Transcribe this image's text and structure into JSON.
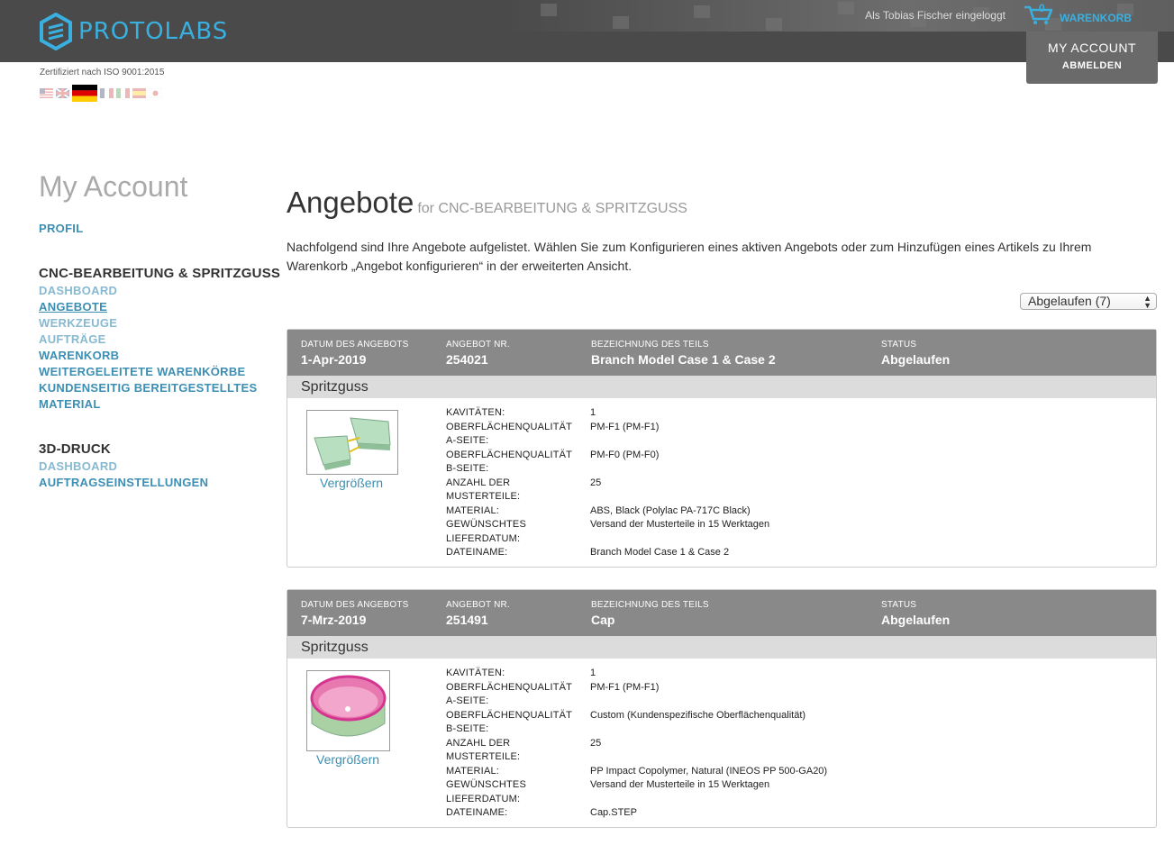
{
  "header": {
    "logo_text": "PROTOLABS",
    "logged_in": "Als Tobias Fischer eingeloggt",
    "cart_count": "0",
    "cart_label": "WARENKORB",
    "account_label": "MY ACCOUNT",
    "logout_label": "ABMELDEN",
    "iso": "Zertifiziert nach ISO 9001:2015"
  },
  "sidebar": {
    "title": "My Account",
    "profile": "PROFIL",
    "section1": "CNC-BEARBEITUNG & SPRITZGUSS",
    "items1": [
      "DASHBOARD",
      "ANGEBOTE",
      "WERKZEUGE",
      "AUFTRÄGE",
      "WARENKORB",
      "WEITERGELEITETE WARENKÖRBE",
      "KUNDENSEITIG BEREITGESTELLTES",
      "MATERIAL"
    ],
    "section2": "3D-DRUCK",
    "items2": [
      "DASHBOARD",
      "AUFTRAGSEINSTELLUNGEN"
    ]
  },
  "main": {
    "title": "Angebote",
    "subtitle": "for CNC-BEARBEITUNG & SPRITZGUSS",
    "intro": "Nachfolgend sind Ihre Angebote aufgelistet. Wählen Sie zum Konfigurieren eines aktiven Angebots oder zum Hinzufügen eines Artikels zu Ihrem Warenkorb „Angebot konfigurieren“ in der erweiterten Ansicht.",
    "filter_value": "Abgelaufen (7)",
    "col_labels": [
      "DATUM DES ANGEBOTS",
      "ANGEBOT NR.",
      "BEZEICHNUNG DES TEILS",
      "STATUS"
    ],
    "zoom_label": "Vergrößern",
    "quotes": [
      {
        "date": "1-Apr-2019",
        "number": "254021",
        "part": "Branch Model Case 1 & Case 2",
        "status": "Abgelaufen",
        "type": "Spritzguss",
        "details": [
          [
            "KAVITÄTEN:",
            "1"
          ],
          [
            "OBERFLÄCHENQUALITÄT",
            "PM-F1 (PM-F1)"
          ],
          [
            "A-SEITE:",
            ""
          ],
          [
            "OBERFLÄCHENQUALITÄT",
            "PM-F0 (PM-F0)"
          ],
          [
            "B-SEITE:",
            ""
          ],
          [
            "ANZAHL DER",
            "25"
          ],
          [
            "MUSTERTEILE:",
            ""
          ],
          [
            "MATERIAL:",
            "ABS, Black (Polylac PA-717C Black)"
          ],
          [
            "GEWÜNSCHTES",
            "Versand der Musterteile in 15 Werktagen"
          ],
          [
            "LIEFERDATUM:",
            ""
          ],
          [
            "DATEINAME:",
            "Branch Model Case 1 & Case 2"
          ]
        ]
      },
      {
        "date": "7-Mrz-2019",
        "number": "251491",
        "part": "Cap",
        "status": "Abgelaufen",
        "type": "Spritzguss",
        "details": [
          [
            "KAVITÄTEN:",
            "1"
          ],
          [
            "OBERFLÄCHENQUALITÄT",
            "PM-F1 (PM-F1)"
          ],
          [
            "A-SEITE:",
            ""
          ],
          [
            "OBERFLÄCHENQUALITÄT",
            "Custom (Kundenspezifische Oberflächenqualität)"
          ],
          [
            "B-SEITE:",
            ""
          ],
          [
            "ANZAHL DER",
            "25"
          ],
          [
            "MUSTERTEILE:",
            ""
          ],
          [
            "MATERIAL:",
            "PP Impact Copolymer, Natural (INEOS PP 500-GA20)"
          ],
          [
            "GEWÜNSCHTES",
            "Versand der Musterteile in 15 Werktagen"
          ],
          [
            "LIEFERDATUM:",
            ""
          ],
          [
            "DATEINAME:",
            "Cap.STEP"
          ]
        ]
      }
    ]
  },
  "colors": {
    "header_bg": "#4a4a4a",
    "accent": "#3ab0e0",
    "link": "#3c8fb3",
    "card_head": "#898989"
  }
}
